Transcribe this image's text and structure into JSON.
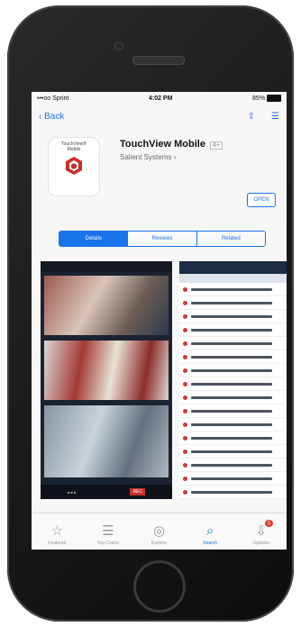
{
  "status_bar": {
    "carrier": "•••oo Sprint",
    "time": "4:02 PM",
    "battery": "85%"
  },
  "nav": {
    "back_label": "Back"
  },
  "app": {
    "name": "TouchView Mobile",
    "badge": "4+",
    "developer": "Salient Systems",
    "icon_title_line1": "TouchView®",
    "icon_title_line2": "Mobile",
    "open_label": "OPEN"
  },
  "segments": [
    "Details",
    "Reviews",
    "Related"
  ],
  "screenshot_rec_label": "REC",
  "tabs": [
    {
      "label": "Featured",
      "icon": "star-icon"
    },
    {
      "label": "Top Charts",
      "icon": "list-icon"
    },
    {
      "label": "Explore",
      "icon": "compass-icon"
    },
    {
      "label": "Search",
      "icon": "search-icon"
    },
    {
      "label": "Updates",
      "icon": "download-icon",
      "count": "1"
    }
  ],
  "colors": {
    "accent": "#1a73e8",
    "badge": "#e0463f"
  }
}
